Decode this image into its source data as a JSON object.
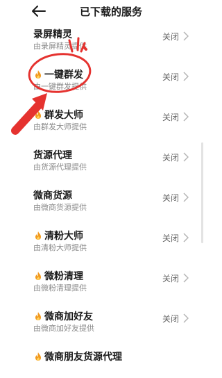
{
  "header": {
    "title": "已下载的服务"
  },
  "services": [
    {
      "name": "录屏精灵",
      "provider": "由录屏精灵提供",
      "status": "关闭",
      "hot": false
    },
    {
      "name": "一键群发",
      "provider": "由一键群发提供",
      "status": "关闭",
      "hot": true
    },
    {
      "name": "群发大师",
      "provider": "由群发大师提供",
      "status": "关闭",
      "hot": true
    },
    {
      "name": "货源代理",
      "provider": "由货源代理提供",
      "status": "关闭",
      "hot": false
    },
    {
      "name": "微商货源",
      "provider": "由微商货源提供",
      "status": "关闭",
      "hot": false
    },
    {
      "name": "清粉大师",
      "provider": "由清粉大师提供",
      "status": "关闭",
      "hot": true
    },
    {
      "name": "微粉清理",
      "provider": "由微粉清理提供",
      "status": "关闭",
      "hot": true
    },
    {
      "name": "微商加好友",
      "provider": "由微商加好友提供",
      "status": "关闭",
      "hot": true
    },
    {
      "name": "微商朋友货源代理",
      "provider": "",
      "status": "",
      "hot": true
    }
  ],
  "colors": {
    "annotation": "#e5322f",
    "fire": "#f29a1f"
  },
  "icons": {
    "back": "arrow-left-icon",
    "chevron": "chevron-right-icon",
    "hot": "fire-icon"
  }
}
